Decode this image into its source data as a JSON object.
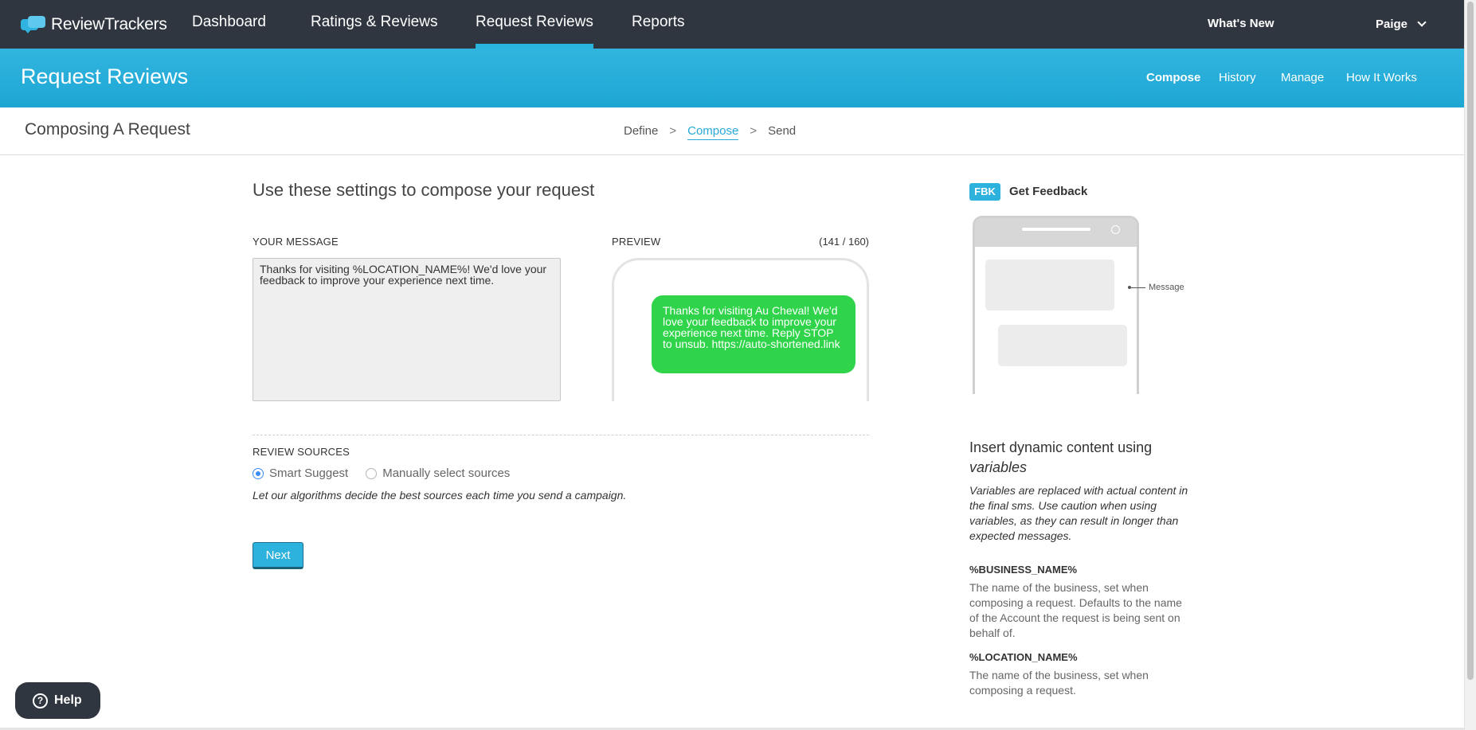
{
  "brand": {
    "name_part1": "Review",
    "name_part2": "Trackers",
    "logo_icon": "chat-bubbles-icon"
  },
  "topnav": {
    "items": [
      {
        "label": "Dashboard",
        "active": false
      },
      {
        "label": "Ratings & Reviews",
        "active": false
      },
      {
        "label": "Request Reviews",
        "active": true
      },
      {
        "label": "Reports",
        "active": false
      }
    ],
    "whats_new": "What's New",
    "user": "Paige"
  },
  "subheader": {
    "title": "Request Reviews",
    "nav": [
      {
        "label": "Compose",
        "active": true
      },
      {
        "label": "History",
        "active": false
      },
      {
        "label": "Manage",
        "active": false
      },
      {
        "label": "How It Works",
        "active": false
      }
    ]
  },
  "stepbar": {
    "title": "Composing A Request",
    "steps": [
      "Define",
      "Compose",
      "Send"
    ],
    "separator": ">",
    "active_step": "Compose"
  },
  "compose": {
    "heading": "Use these settings to compose your request",
    "message_label": "YOUR MESSAGE",
    "message_value": "Thanks for visiting %LOCATION_NAME%! We'd love your feedback to improve your experience next time.",
    "preview_label": "PREVIEW",
    "char_count": "(141 / 160)",
    "preview_text": "Thanks for visiting Au Cheval! We'd love your feedback to improve your experience next time. Reply STOP to unsub. https://auto-shortened.link",
    "review_sources_label": "REVIEW SOURCES",
    "sources_options": [
      {
        "label": "Smart Suggest",
        "checked": true
      },
      {
        "label": "Manually select sources",
        "checked": false
      }
    ],
    "sources_hint": "Let our algorithms decide the best sources each time you send a campaign.",
    "next_label": "Next"
  },
  "sidebar": {
    "badge": "FBK",
    "title": "Get Feedback",
    "callout_label": "Message",
    "vars_title_prefix": "Insert dynamic content using",
    "vars_title_em": "variables",
    "vars_desc": "Variables are replaced with actual content in the final sms. Use caution when using variables, as they can result in longer than expected messages.",
    "variables": [
      {
        "name": "%BUSINESS_NAME%",
        "desc": "The name of the business, set when composing a request. Defaults to the name of the Account the request is being sent on behalf of."
      },
      {
        "name": "%LOCATION_NAME%",
        "desc": "The name of the business, set when composing a request."
      }
    ]
  },
  "help": {
    "label": "Help"
  },
  "colors": {
    "nav_bg": "#2f3640",
    "accent": "#29b4dd",
    "sms_bubble": "#2fd44a"
  }
}
